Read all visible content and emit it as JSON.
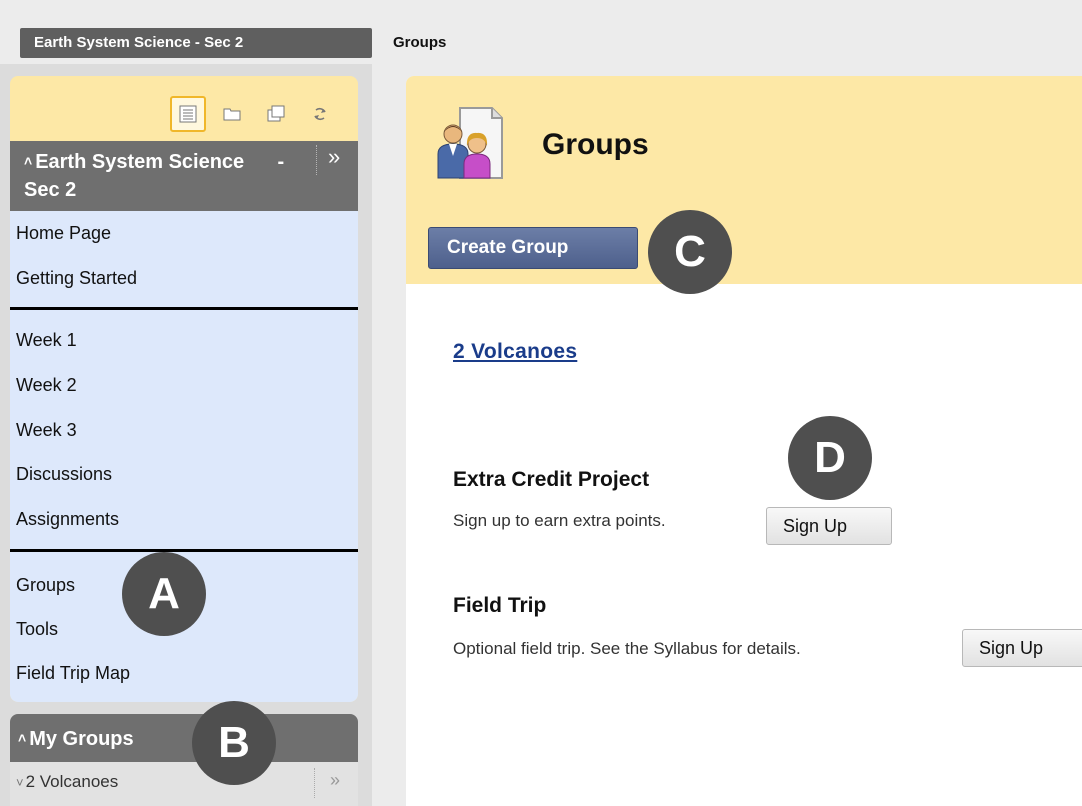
{
  "breadcrumb": {
    "course": "Earth System Science - Sec 2",
    "page": "Groups"
  },
  "course_menu": {
    "title": "Earth System Science      - Sec 2",
    "tools": [
      "list-view-icon",
      "folder-view-icon",
      "new-window-icon",
      "refresh-icon"
    ],
    "section1": [
      "Home Page",
      "Getting Started"
    ],
    "section2": [
      "Week 1",
      "Week 2",
      "Week 3",
      "Discussions",
      "Assignments"
    ],
    "section3": [
      "Groups",
      "Tools",
      "Field Trip Map"
    ]
  },
  "my_groups": {
    "title": "My Groups",
    "items": [
      "2 Volcanoes"
    ]
  },
  "main": {
    "title": "Groups",
    "create_button": "Create Group",
    "group_link": "2 Volcanoes",
    "signup_sheets": [
      {
        "title": "Extra Credit Project",
        "description": "Sign up to earn extra points.",
        "button": "Sign Up"
      },
      {
        "title": "Field Trip",
        "description": "Optional field trip. See the Syllabus for details.",
        "button": "Sign Up"
      }
    ]
  },
  "callouts": [
    "A",
    "B",
    "C",
    "D"
  ],
  "colors": {
    "header_bg": "#fde8a6",
    "menu_list_bg": "#dde8fb",
    "button_bg": "#5a6b96",
    "marker_bg": "#4f4f4f"
  }
}
